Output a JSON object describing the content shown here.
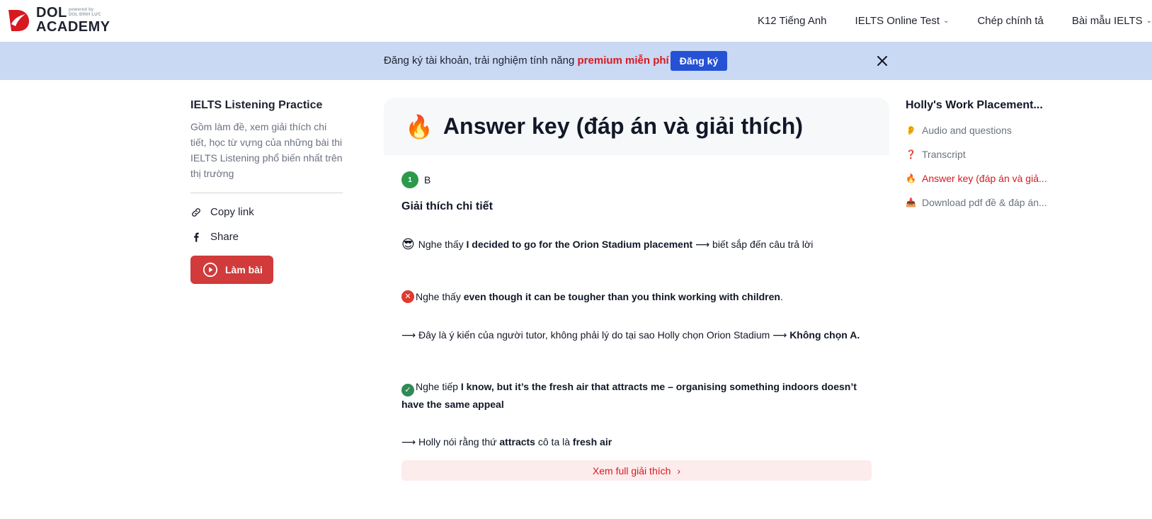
{
  "header": {
    "logo": {
      "powered_line1": "powered by",
      "powered_line2": "DOL ĐÌNH LỰC",
      "brand_line1": "DOL",
      "brand_line2": "ACADEMY"
    },
    "nav": [
      {
        "label": "K12 Tiếng Anh",
        "has_dropdown": false
      },
      {
        "label": "IELTS Online Test",
        "has_dropdown": true
      },
      {
        "label": "Chép chính tả",
        "has_dropdown": false
      },
      {
        "label": "Bài mẫu IELTS",
        "has_dropdown": true
      }
    ]
  },
  "banner": {
    "text": "Đăng ký tài khoản, trải nghiệm tính năng ",
    "highlight": "premium miễn phí",
    "button_label": "Đăng ký"
  },
  "left": {
    "title": "IELTS Listening Practice",
    "description": "Gồm làm đề, xem giải thích chi tiết, học từ vựng của những bài thi IELTS Listening phổ biến nhất trên thị trường",
    "copy_link": "Copy link",
    "share": "Share",
    "do_button": "Làm bài"
  },
  "main": {
    "title_icon": "🔥",
    "title": "Answer key (đáp án và giải thích)",
    "question_number": "1",
    "answer": "B",
    "explain_title": "Giải thích chi tiết",
    "p1_icon": "😎",
    "p1_prefix": "Nghe thấy ",
    "p1_bold": "I decided to go for the Orion Stadium placement",
    "p1_suffix": " ⟶ biết sắp đến câu trả lời",
    "p2_prefix": "Nghe thấy  ",
    "p2_bold": "even though it can be tougher than you think working with children",
    "p2_suffix": ".",
    "p3_prefix": "⟶ Đây là ý kiến của người tutor, không phải lý do tại sao Holly chọn Orion Stadium ⟶ ",
    "p3_bold": "Không chọn A.",
    "p4_prefix": "Nghe tiếp ",
    "p4_bold": "I know, but it’s the fresh air that attracts me – organising something indoors doesn’t have the same appeal",
    "p5_prefix": "⟶ Holly nói rằng thứ ",
    "p5_bold1": "attracts",
    "p5_mid": " cô ta là ",
    "p5_bold2": "fresh air",
    "full_button": "Xem full giải thích"
  },
  "toc": {
    "title": "Holly's Work Placement...",
    "items": [
      {
        "icon": "👂",
        "label": "Audio and questions",
        "active": false
      },
      {
        "icon": "❓",
        "label": "Transcript",
        "active": false
      },
      {
        "icon": "🔥",
        "label": "Answer key (đáp án và giả...",
        "active": true
      },
      {
        "icon": "📥",
        "label": "Download pdf đề & đáp án...",
        "active": false
      }
    ]
  },
  "colors": {
    "brand_red": "#d71920",
    "banner_bg": "#c9d8f3",
    "signup_blue": "#2551d4",
    "do_button_red": "#d13b3b",
    "answer_badge_green": "#2c9a4b"
  }
}
